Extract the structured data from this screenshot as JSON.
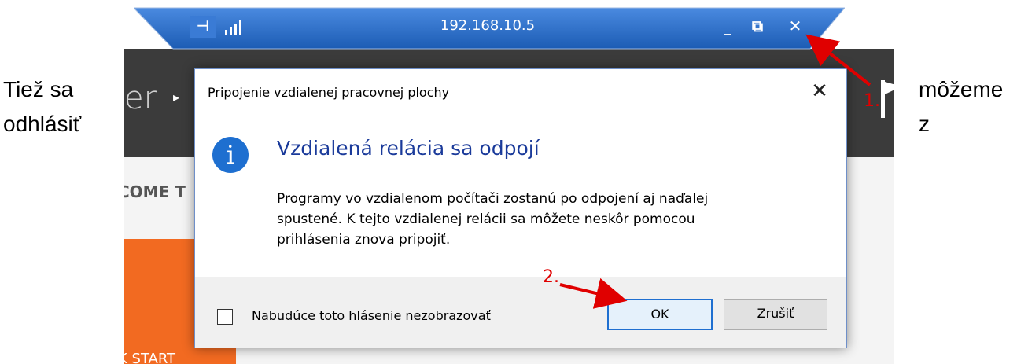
{
  "side_captions": {
    "left_line1": "Tiež sa",
    "left_line2": "odhlásiť",
    "right_line1": "môžeme",
    "right_line2": "z"
  },
  "background_app": {
    "title_fragment": "er",
    "welcome_fragment": "COME T",
    "quick_start_fragment": "K START",
    "header_color": "#3b3b3b",
    "tile_color": "#f26a21"
  },
  "connection_bar": {
    "address": "192.168.10.5",
    "pin_icon": "pin-icon",
    "signal_icon": "signal-icon",
    "minimize_icon": "minimize-icon",
    "restore_icon": "restore-icon",
    "close_icon": "close-icon",
    "color": "#2c6fc7"
  },
  "dialog": {
    "title": "Pripojenie vzdialenej pracovnej plochy",
    "heading": "Vzdialená relácia sa odpojí",
    "body": "Programy vo vzdialenom počítači zostanú po odpojení aj naďalej\nspustené. K tejto vzdialenej relácii sa môžete neskôr pomocou\nprihlásenia znova pripojiť.",
    "info_icon": "info-icon",
    "checkbox_label": "Nabudúce toto hlásenie nezobrazovať",
    "checkbox_checked": false,
    "ok_label": "OK",
    "cancel_label": "Zrušiť"
  },
  "annotations": {
    "step1": "1.",
    "step2": "2.",
    "color": "#e00000"
  }
}
